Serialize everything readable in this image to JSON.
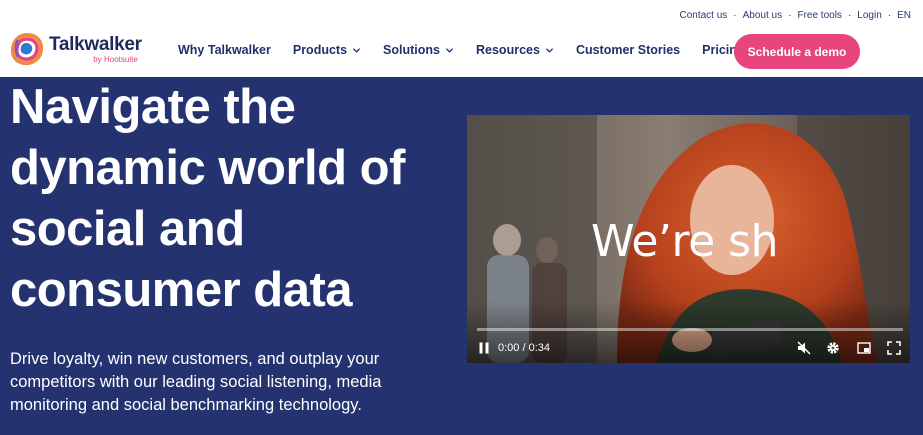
{
  "utility_links": [
    "Contact us",
    "About us",
    "Free tools",
    "Login",
    "EN"
  ],
  "utility_separator": "·",
  "logo": {
    "name": "Talkwalker",
    "sub": "by Hootsuite"
  },
  "nav": [
    {
      "label": "Why Talkwalker",
      "dropdown": false
    },
    {
      "label": "Products",
      "dropdown": true
    },
    {
      "label": "Solutions",
      "dropdown": true
    },
    {
      "label": "Resources",
      "dropdown": true
    },
    {
      "label": "Customer Stories",
      "dropdown": false
    },
    {
      "label": "Pricing",
      "dropdown": false
    }
  ],
  "cta": "Schedule a demo",
  "hero": {
    "title": [
      "Navigate the",
      "dynamic world of",
      "social and",
      "consumer data"
    ],
    "subtitle": [
      "Drive loyalty, win new customers, and outplay your",
      "competitors with our leading social listening, media",
      "monitoring and social benchmarking technology."
    ]
  },
  "video": {
    "caption": "We’re sh",
    "time": "0:00 / 0:34",
    "progress": 0
  },
  "colors": {
    "brand_navy": "#243270",
    "cta_pink": "#e8457e",
    "nav_text": "#22306a"
  }
}
